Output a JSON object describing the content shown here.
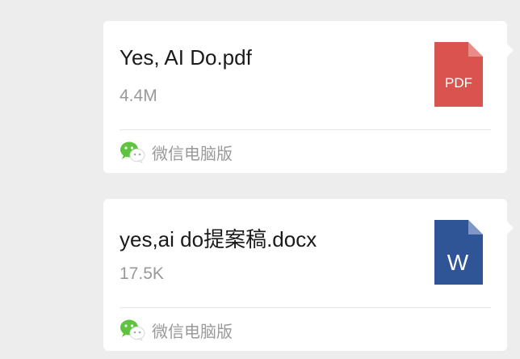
{
  "messages": [
    {
      "file_name": "Yes, AI Do.pdf",
      "file_size": "4.4M",
      "file_type_label": "PDF",
      "file_icon": "pdf-file-icon",
      "icon_color": "#d9534f",
      "source_label": "微信电脑版",
      "source_icon": "wechat-icon"
    },
    {
      "file_name": "yes,ai do提案稿.docx",
      "file_size": "17.5K",
      "file_type_label": "W",
      "file_icon": "word-file-icon",
      "icon_color": "#2f5597",
      "source_label": "微信电脑版",
      "source_icon": "wechat-icon"
    }
  ],
  "colors": {
    "background": "#ededed",
    "bubble": "#ffffff",
    "wechat_green": "#5ec33f"
  }
}
